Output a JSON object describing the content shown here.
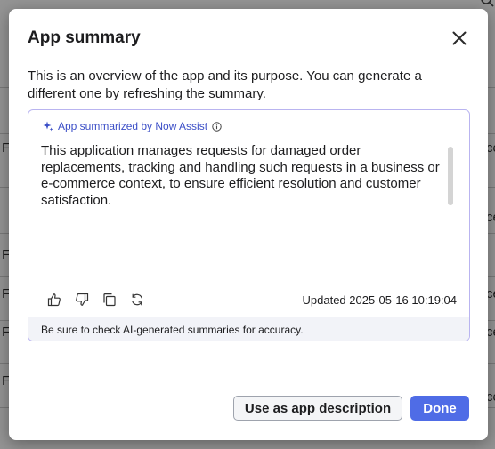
{
  "background": {
    "rows": [
      {
        "left": "F",
        "right": "ce"
      },
      {
        "left": "F",
        "right": "ce"
      },
      {
        "left": "F",
        "right": "ce"
      },
      {
        "left": "F",
        "right": "ce"
      },
      {
        "left": "F",
        "right": "ce"
      }
    ]
  },
  "dialog": {
    "title": "App summary",
    "intro": "This is an overview of the app and its purpose. You can generate a different one by refreshing the summary.",
    "ai_label": "App summarized by Now Assist",
    "summary": "This application manages requests for damaged order replacements, tracking and handling such requests in a business or e-commerce context, to ensure efficient resolution and customer satisfaction.",
    "updated": "Updated 2025-05-16 10:19:04",
    "disclaimer": "Be sure to check AI-generated summaries for accuracy.",
    "buttons": {
      "use_description": "Use as app description",
      "done": "Done"
    }
  },
  "colors": {
    "accent": "#4f6ce6",
    "ai_text": "#3c4fc7",
    "panel_border": "#b9b4f0"
  }
}
